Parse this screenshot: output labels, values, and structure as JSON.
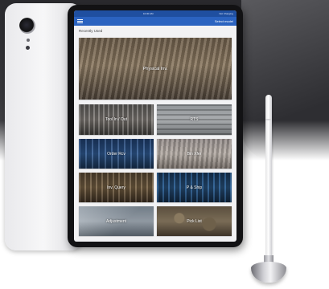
{
  "status_bar": {
    "carrier": "",
    "time": "10:30 AM",
    "battery": "Not Charging"
  },
  "app_bar": {
    "action_label": "Select model"
  },
  "recent": {
    "title": "Recently Used",
    "tiles": [
      {
        "label": "Physical Inv."
      },
      {
        "label": "Tool In / Out"
      },
      {
        "label": "RTS"
      },
      {
        "label": "Order Rcv"
      },
      {
        "label": "Bin Xfer"
      },
      {
        "label": "Inv. Query"
      },
      {
        "label": "P & Ship"
      },
      {
        "label": "Adjustment"
      },
      {
        "label": "Pick List"
      }
    ]
  },
  "colors": {
    "status_bar": "#1f4fa0",
    "app_bar": "#2b63c0",
    "screen_bg": "#f2f2f4"
  }
}
